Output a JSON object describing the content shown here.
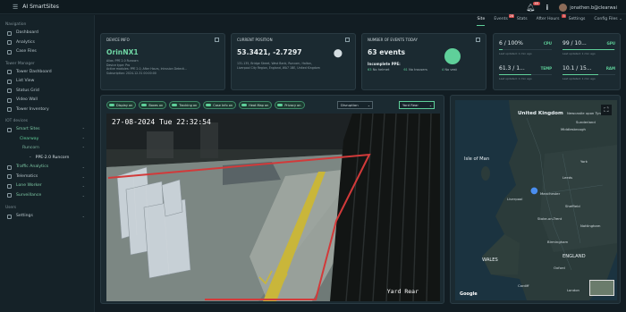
{
  "app": {
    "title": "AI SmartSites"
  },
  "topbar": {
    "notifications_badge": "45",
    "user_email": "jonathen.b@clearwai"
  },
  "tabs": [
    {
      "label": "Site",
      "active": true,
      "badge": ""
    },
    {
      "label": "Events",
      "active": false,
      "badge": "28"
    },
    {
      "label": "Stats",
      "active": false,
      "badge": ""
    },
    {
      "label": "After Hours",
      "active": false,
      "badge": "3"
    },
    {
      "label": "Settings",
      "active": false,
      "badge": ""
    },
    {
      "label": "Config Files",
      "active": false,
      "badge": ""
    }
  ],
  "sidebar": {
    "navigation_heading": "Navigation",
    "navigation": [
      "Dashboard",
      "Analytics",
      "Case Files"
    ],
    "tower_heading": "Tower Manager",
    "tower": [
      "Tower Dashboard",
      "List View",
      "Status Grid",
      "Video Wall",
      "Tower Inventory"
    ],
    "iot_heading": "IOT devices",
    "smart_sites": "Smart Sites",
    "clearway": "Clearway",
    "runcorn": "Runcorn",
    "device": "PPE-2.0 Runcorn",
    "iot_more": [
      "Traffic Analytics",
      "Telematics",
      "Lone Worker",
      "Surveillance"
    ],
    "users_heading": "Users",
    "settings": "Settings"
  },
  "device_info": {
    "title": "DEVICE INFO",
    "name": "OrinNX1",
    "details": "Alias: PPE 2.0 Runcorn\nDevice type: Pro\nActive modules: PPE 2.0, After Hours, Intrusion Detecti...\nSubscription: 2024-12-31 00:00:00"
  },
  "position": {
    "title": "CURRENT POSITION",
    "coords": "53.3421, -2.7297",
    "address": "131-135, Bridge Street, West Bank, Runcorn, Halton,\nLiverpool City Region, England, WA7 1BE, United Kingdom"
  },
  "events": {
    "title": "NUMBER OF EVENTS TODAY",
    "count": "63 events",
    "ppe_label": "Incomplete PPE:",
    "ppe": [
      {
        "n": "63",
        "label": "No helmet"
      },
      {
        "n": "61",
        "label": "No trousers"
      },
      {
        "n": "4",
        "label": "No vest"
      }
    ],
    "share": 1.0,
    "donut_color": "#5fd09a"
  },
  "stats": {
    "items": [
      {
        "value": "6 / 100%",
        "label": "CPU",
        "updated": "Last updated: 1 min ago",
        "fill": 0.06
      },
      {
        "value": "99 / 10...",
        "label": "GPU",
        "updated": "Last updated: 1 min ago",
        "fill": 0.99
      },
      {
        "value": "61.3 / 1...",
        "label": "TEMP",
        "updated": "Last updated: 1 min ago",
        "fill": 0.61
      },
      {
        "value": "10.1 / 15...",
        "label": "RAM",
        "updated": "Last updated: 1 min ago",
        "fill": 0.67
      }
    ]
  },
  "video": {
    "chips": [
      "Display on",
      "Boxes on",
      "Tracking on",
      "Case Info on",
      "Heat Map on",
      "Privacy on"
    ],
    "select1": "Disruption",
    "select2": "Yard Rear",
    "timestamp": "27-08-2024 Tue 22:32:54",
    "camera_label": "Yard Rear"
  },
  "map": {
    "labels": {
      "united_kingdom": "United Kingdom",
      "newcastle": "Newcastle upon Tyne",
      "sunderland": "Sunderland",
      "middlesbrough": "Middlesbrough",
      "isle_of_man": "Isle of Man",
      "york": "York",
      "leeds": "Leeds",
      "liverpool": "Liverpool",
      "manchester": "Manchester",
      "sheffield": "Sheffield",
      "stoke": "Stoke-on-Trent",
      "nottingham": "Nottingham",
      "birmingham": "Birmingham",
      "wales": "WALES",
      "england": "ENGLAND",
      "cardiff": "Cardiff",
      "london": "London",
      "oxford": "Oxford",
      "google": "Google"
    }
  }
}
